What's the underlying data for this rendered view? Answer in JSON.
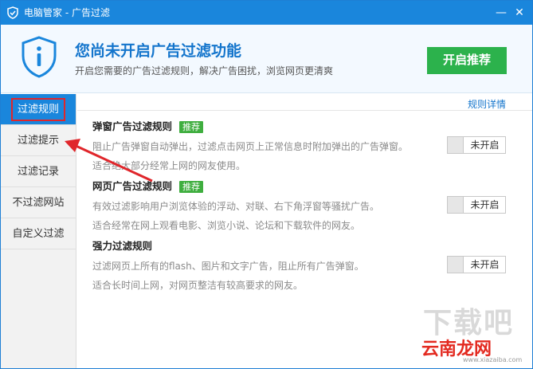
{
  "window": {
    "title": "电脑管家 - 广告过滤",
    "minimize_glyph": "—",
    "close_glyph": "✕"
  },
  "header": {
    "headline": "您尚未开启广告过滤功能",
    "subline": "开启您需要的广告过滤规则，解决广告困扰，浏览网页更清爽",
    "enable_button": "开启推荐"
  },
  "sidebar": {
    "items": [
      {
        "label": "过滤规则",
        "active": true
      },
      {
        "label": "过滤提示",
        "active": false
      },
      {
        "label": "过滤记录",
        "active": false
      },
      {
        "label": "不过滤网站",
        "active": false
      },
      {
        "label": "自定义过滤",
        "active": false
      }
    ]
  },
  "content": {
    "detail_link": "规则详情",
    "rules": [
      {
        "name": "弹窗广告过滤规则",
        "badge": "推荐",
        "desc": "阻止广告弹窗自动弹出，过滤点击网页上正常信息时附加弹出的广告弹窗。",
        "hint": "适合绝大部分经常上网的网友使用。",
        "toggle": "未开启"
      },
      {
        "name": "网页广告过滤规则",
        "badge": "推荐",
        "desc": "有效过滤影响用户浏览体验的浮动、对联、右下角浮窗等骚扰广告。",
        "hint": "适合经常在网上观看电影、浏览小说、论坛和下载软件的网友。",
        "toggle": "未开启"
      },
      {
        "name": "强力过滤规则",
        "badge": "",
        "desc": "过滤网页上所有的flash、图片和文字广告，阻止所有广告弹窗。",
        "hint": "适合长时间上网，对网页整洁有较高要求的网友。",
        "toggle": "未开启"
      }
    ]
  },
  "watermark": {
    "big": "下载吧",
    "brand": "云南龙网",
    "url": "www.xiazaiba.com"
  },
  "colors": {
    "accent": "#1a86dc",
    "green": "#2cb24c",
    "annotation": "#e0262b"
  },
  "icons": {
    "title_logo": "shield-icon",
    "header_logo": "shield-info-icon"
  }
}
